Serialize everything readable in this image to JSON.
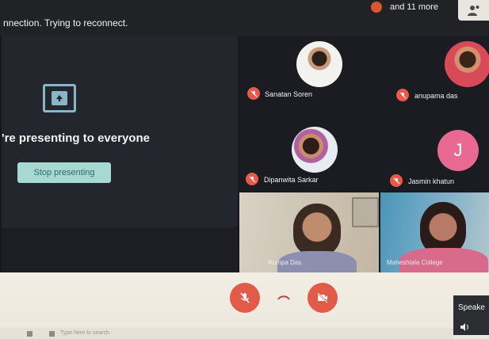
{
  "top_bar": {
    "connection_message": "nnection. Trying to reconnect.",
    "more_participants": "and 11 more"
  },
  "presentation": {
    "message": "'re presenting to everyone",
    "stop_button_label": "Stop presenting"
  },
  "participants": [
    {
      "name": "Sanatan Soren",
      "muted": true
    },
    {
      "name": "anupama das",
      "muted": true
    },
    {
      "name": "Dipanwita Sarkar",
      "muted": true
    },
    {
      "name": "Jasmin khatun",
      "muted": true,
      "initial": "J",
      "avatar_color": "#e86a92"
    }
  ],
  "videos": [
    {
      "name": "Rumpa Das"
    },
    {
      "name": "Maheshtala College"
    }
  ],
  "controls": {
    "speaker_label": "Speake"
  },
  "taskbar": {
    "search_placeholder": "Type here to search"
  },
  "colors": {
    "accent_button": "#a8d8d2",
    "mic_off": "#e8594a",
    "end_call_controls": "#e25a48"
  }
}
